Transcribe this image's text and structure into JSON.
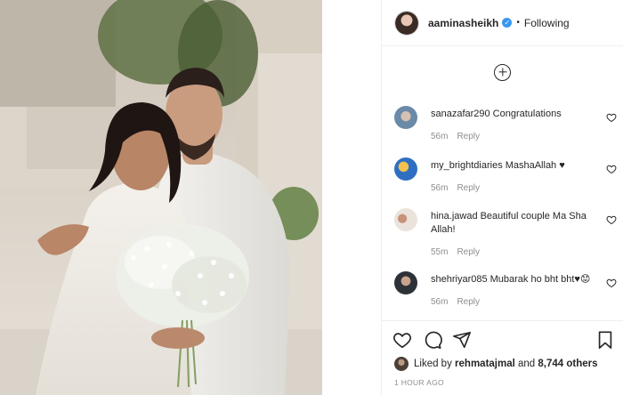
{
  "post": {
    "username": "aaminasheikh",
    "verified_icon": "verified-badge-icon",
    "separator": "•",
    "follow_status": "Following",
    "image_alt_desc": ""
  },
  "comments": [
    {
      "username": "sanazafar290",
      "text": "Congratulations",
      "age": "56m",
      "reply": "Reply"
    },
    {
      "username": "my_brightdiaries",
      "text": "MashaAllah ♥",
      "age": "56m",
      "reply": "Reply"
    },
    {
      "username": "hina.jawad",
      "text": "Beautiful couple Ma Sha Allah!",
      "age": "55m",
      "reply": "Reply"
    },
    {
      "username": "shehriyar085",
      "text": "Mubarak ho bht bht♥😟",
      "age": "56m",
      "reply": "Reply"
    }
  ],
  "likes": {
    "prefix": "Liked by",
    "user": "rehmatajmal",
    "connector": "and",
    "count": "8,744 others"
  },
  "timestamp": "1 HOUR AGO",
  "colors": {
    "accent_blue": "#3897f0",
    "text": "#262626",
    "muted": "#8e8e8e",
    "border": "#efefef"
  }
}
